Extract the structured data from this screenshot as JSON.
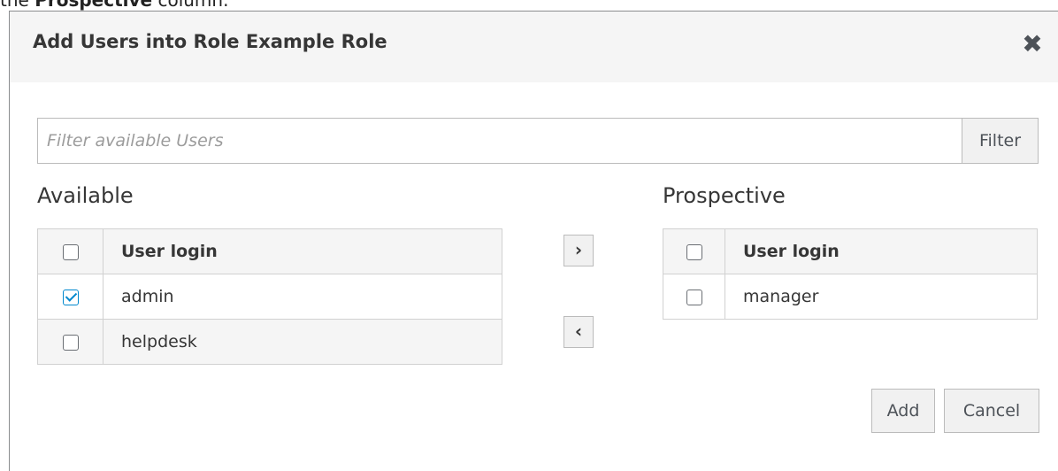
{
  "context": {
    "prefix": "the ",
    "bold": "Prospective",
    "suffix": " column."
  },
  "dialog": {
    "title": "Add Users into Role Example Role",
    "close_icon": "close-icon"
  },
  "filter": {
    "placeholder": "Filter available Users",
    "value": "",
    "button_label": "Filter"
  },
  "available": {
    "label": "Available",
    "header": "User login",
    "rows": [
      {
        "login": "admin",
        "checked": true
      },
      {
        "login": "helpdesk",
        "checked": false
      }
    ]
  },
  "prospective": {
    "label": "Prospective",
    "header": "User login",
    "rows": [
      {
        "login": "manager",
        "checked": false
      }
    ]
  },
  "move": {
    "right_label": "›",
    "left_label": "‹"
  },
  "footer": {
    "add_label": "Add",
    "cancel_label": "Cancel"
  },
  "colors": {
    "checkbox_checked": "#0088ce",
    "header_bg": "#f5f5f5"
  }
}
